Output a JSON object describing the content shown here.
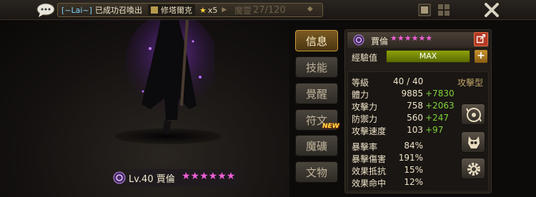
{
  "topbar": {
    "chat_icon": "speech-bubble-icon",
    "announce_user": "[~Lai~]",
    "announce_msg": "已成功召喚出",
    "announce_monster": "修塔爾克",
    "announce_star": "★",
    "announce_count": "x5",
    "bag_label": "魔靈",
    "bag_count": "27/120",
    "close_icon": "close-x-icon"
  },
  "hero": {
    "level": "Lv.40",
    "name": "賈倫",
    "stars": "★★★★★★",
    "attribute_icon": "dark-attribute-icon"
  },
  "tabs": [
    {
      "label": "信息",
      "active": true
    },
    {
      "label": "技能"
    },
    {
      "label": "覺醒"
    },
    {
      "label": "符文"
    },
    {
      "label": "魔礦"
    },
    {
      "label": "文物"
    }
  ],
  "new_badge": "NEW",
  "panel": {
    "name": "賈倫",
    "stars": "★★★★★★",
    "exp_label": "經驗值",
    "exp_value": "MAX",
    "exp_plus": "+",
    "type": "攻擊型",
    "stats": [
      {
        "label": "等級",
        "value": "40 / 40",
        "bonus": ""
      },
      {
        "label": "體力",
        "value": "9885",
        "bonus": "+7830"
      },
      {
        "label": "攻擊力",
        "value": "758",
        "bonus": "+2063"
      },
      {
        "label": "防禦力",
        "value": "560",
        "bonus": "+247"
      },
      {
        "label": "攻擊速度",
        "value": "103",
        "bonus": "+97"
      },
      {
        "label": "暴擊率",
        "value": "84%",
        "bonus": ""
      },
      {
        "label": "暴擊傷害",
        "value": "191%",
        "bonus": ""
      },
      {
        "label": "效果抵抗",
        "value": "15%",
        "bonus": ""
      },
      {
        "label": "效果命中",
        "value": "12%",
        "bonus": ""
      }
    ],
    "side_buttons": [
      "rotate-skill-icon",
      "monster-skull-icon",
      "gear-icon"
    ]
  },
  "colors": {
    "star": "#f05fd8",
    "bonus": "#7ed33a",
    "accent": "#c99a3a"
  }
}
